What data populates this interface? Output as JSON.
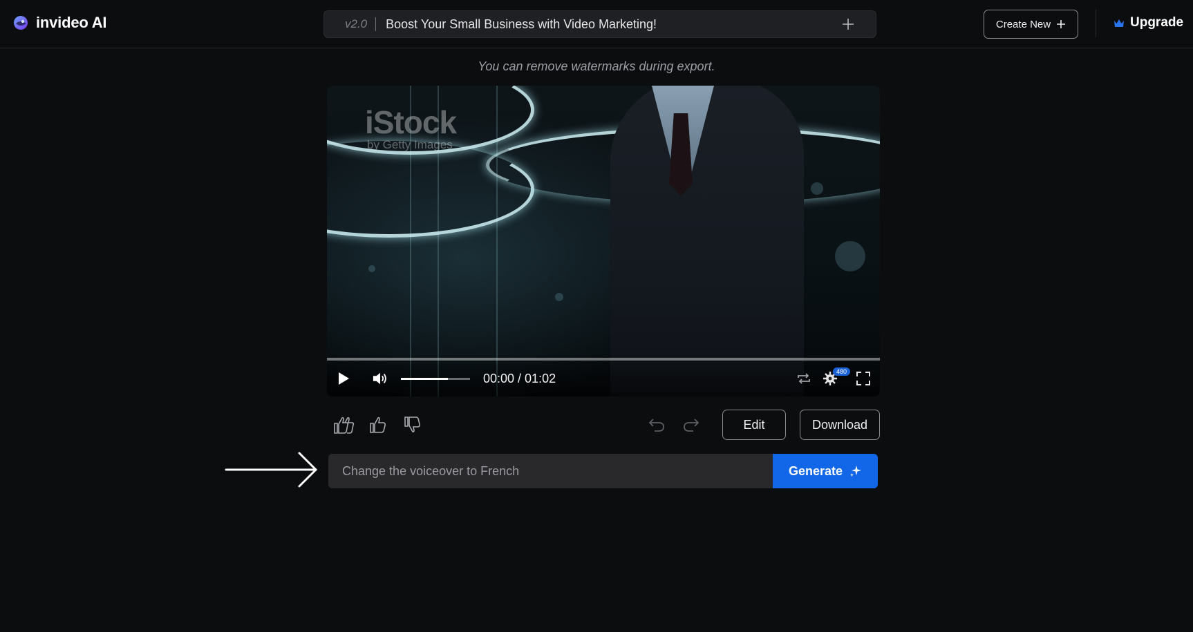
{
  "app": {
    "brand_name": "invideo AI",
    "logo_icon": "invideo-logo-icon"
  },
  "header": {
    "version_label": "v2.0",
    "project_title": "Boost Your Small Business with Video Marketing!",
    "add_icon": "plus-icon",
    "create_new_label": "Create New",
    "upgrade_label": "Upgrade",
    "upgrade_icon": "crown-icon"
  },
  "notice": {
    "text": "You can remove watermarks during export."
  },
  "player": {
    "watermark_brand": "iStock",
    "watermark_sub": "by Getty Images",
    "progress_fraction": 0.0,
    "volume_fraction": 0.68,
    "time_display": "00:00 / 01:02",
    "quality_badge": "480",
    "icons": [
      "play-icon",
      "volume-icon",
      "loop-icon",
      "settings-icon",
      "fullscreen-icon"
    ]
  },
  "actions": {
    "edit_label": "Edit",
    "download_label": "Download",
    "feedback_icons": [
      "double-thumbs-up-icon",
      "thumbs-up-icon",
      "thumbs-down-icon"
    ],
    "history_icons": [
      "undo-icon",
      "redo-icon"
    ]
  },
  "prompt": {
    "placeholder": "Change the voiceover to French",
    "value": "",
    "generate_label": "Generate",
    "generate_icon": "sparkle-icon"
  },
  "colors": {
    "background": "#0c0d0f",
    "accent": "#1167e8",
    "quality_badge": "#1b61d6",
    "input_background": "#29292c"
  }
}
